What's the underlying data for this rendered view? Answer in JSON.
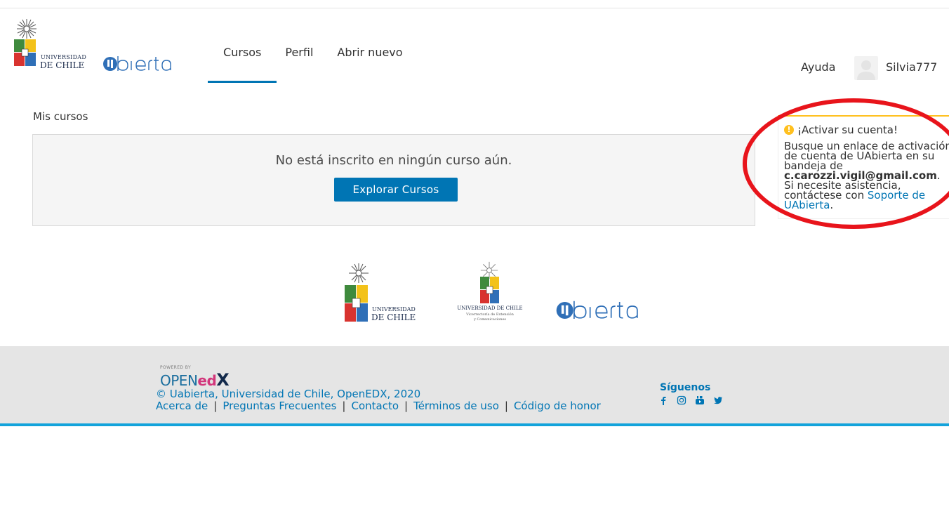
{
  "brand": {
    "uchile_small": "UNIVERSIDAD",
    "uchile_big": "DE CHILE",
    "ua_logo": "uabierta",
    "vext_line1": "UNIVERSIDAD DE CHILE",
    "vext_line2": "Vicerrectoría de Extensión",
    "vext_line3": "y Comunicaciones"
  },
  "nav": {
    "items": [
      {
        "label": "Cursos",
        "active": true
      },
      {
        "label": "Perfil",
        "active": false
      },
      {
        "label": "Abrir nuevo",
        "active": false
      }
    ],
    "help": "Ayuda",
    "username": "Silvia777"
  },
  "main": {
    "section_title": "Mis cursos",
    "empty_message": "No está inscrito en ningún curso aún.",
    "explore_button": "Explorar Cursos"
  },
  "notice": {
    "title": "¡Activar su cuenta!",
    "body_before": "Busque un enlace de activación de cuenta de UAbierta en su bandeja de ",
    "email": "c.carozzi.vigil@gmail.com",
    "body_after": ". Si necesite asistencia, contáctese con ",
    "link": "Soporte de UAbierta",
    "end": "."
  },
  "footer": {
    "powered_by": "POWERED BY",
    "openedx_open": "OPEN",
    "openedx_ed": "ed",
    "openedx_x": "X",
    "copyright": "© Uabierta, Universidad de Chile, OpenEDX, 2020",
    "links": [
      "Acerca de",
      "Preguntas Frecuentes",
      "Contacto",
      "Términos de uso",
      "Código de honor"
    ],
    "separator": "|",
    "follow": "Síguenos",
    "social_icons": [
      "facebook-icon",
      "instagram-icon",
      "youtube-icon",
      "twitter-icon"
    ]
  },
  "colors": {
    "accent": "#0075b4",
    "warning": "#ffc01f",
    "footer_line": "#13a3db",
    "annotation": "#e8141b"
  }
}
